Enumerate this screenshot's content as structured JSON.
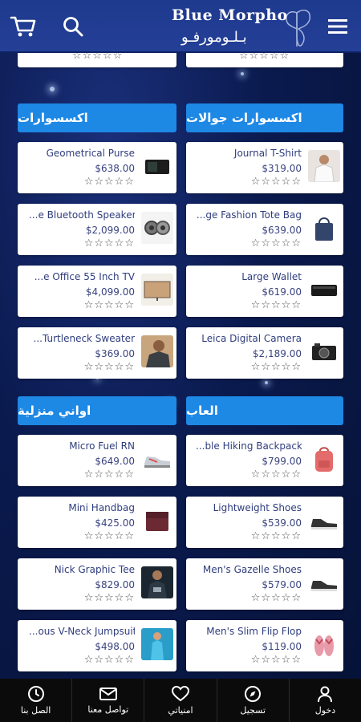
{
  "header": {
    "logo_en": "Blue Morpho",
    "logo_ar": "بـلـومورفـو"
  },
  "sections": [
    {
      "title": "اكسسوارات جوالات",
      "products": [
        {
          "name": "Journal T-Shirt",
          "price": "$319.00",
          "icon": "tshirt-icon"
        },
        {
          "name": "ge Fashion Tote Bag",
          "price": "$639.00",
          "icon": "tote-bag-icon"
        },
        {
          "name": "Large Wallet",
          "price": "$619.00",
          "icon": "wallet-icon"
        },
        {
          "name": "Leica Digital Camera",
          "price": "$2,189.00",
          "icon": "camera-icon"
        }
      ]
    },
    {
      "title": "اكسسوارات",
      "products": [
        {
          "name": "Geometrical Purse",
          "price": "$638.00",
          "icon": "purse-icon"
        },
        {
          "name": "e Bluetooth Speaker",
          "price": "$2,099.00",
          "icon": "speaker-icon"
        },
        {
          "name": "e Office 55 Inch TV",
          "price": "$4,099.00",
          "icon": "tv-icon"
        },
        {
          "name": "Turtleneck Sweater",
          "price": "$369.00",
          "icon": "sweater-icon"
        }
      ]
    },
    {
      "title": "العاب",
      "products": [
        {
          "name": "ble Hiking Backpack",
          "price": "$799.00",
          "icon": "backpack-icon"
        },
        {
          "name": "Lightweight Shoes",
          "price": "$539.00",
          "icon": "shoe-icon"
        },
        {
          "name": "Men's Gazelle Shoes",
          "price": "$579.00",
          "icon": "shoe-icon"
        },
        {
          "name": "Men's Slim Flip Flop",
          "price": "$119.00",
          "icon": "flip-flop-icon"
        }
      ]
    },
    {
      "title": "اواني منزلية",
      "products": [
        {
          "name": "Micro Fuel RN",
          "price": "$649.00",
          "icon": "sneaker-icon"
        },
        {
          "name": "Mini Handbag",
          "price": "$425.00",
          "icon": "handbag-icon"
        },
        {
          "name": "Nick Graphic Tee",
          "price": "$829.00",
          "icon": "tee-icon"
        },
        {
          "name": "ous V-Neck Jumpsuit",
          "price": "$498.00",
          "icon": "jumpsuit-icon"
        }
      ]
    }
  ],
  "rating_stars": "☆☆☆☆☆",
  "truncation": "...",
  "bottom_nav": [
    {
      "label": "الصل بنا",
      "icon": "clock-icon"
    },
    {
      "label": "تواصل معنا",
      "icon": "envelope-icon"
    },
    {
      "label": "امنياتي",
      "icon": "heart-icon"
    },
    {
      "label": "تسجيل",
      "icon": "compass-icon"
    },
    {
      "label": "دخول",
      "icon": "user-icon"
    }
  ],
  "colors": {
    "header": "#1e3a8e",
    "section_head": "#1e88e5",
    "background": "#0a1a4e",
    "nav": "#0b0b0b"
  }
}
